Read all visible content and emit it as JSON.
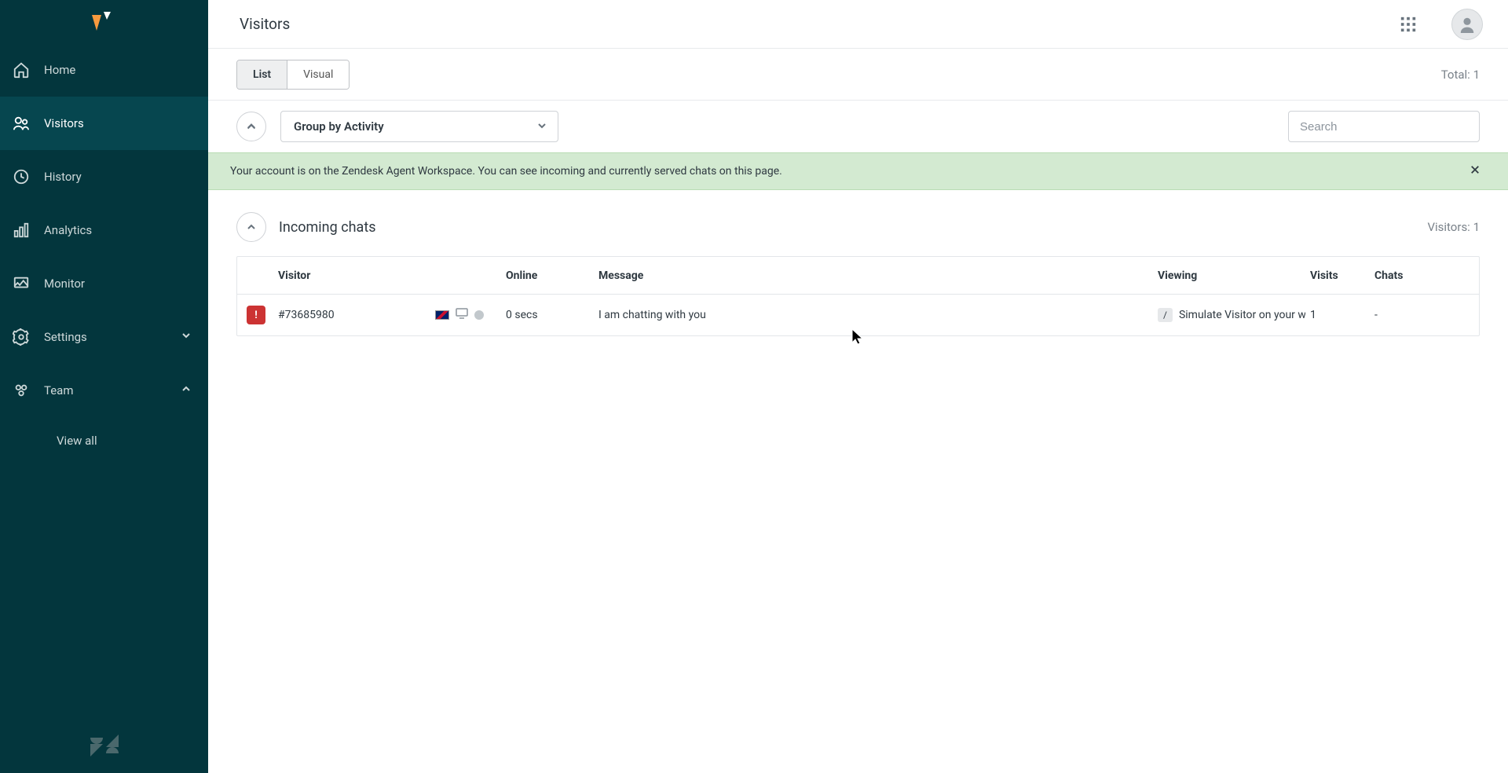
{
  "header": {
    "title": "Visitors"
  },
  "sidebar": {
    "items": [
      {
        "label": "Home"
      },
      {
        "label": "Visitors"
      },
      {
        "label": "History"
      },
      {
        "label": "Analytics"
      },
      {
        "label": "Monitor"
      },
      {
        "label": "Settings"
      },
      {
        "label": "Team"
      }
    ],
    "subitems": [
      {
        "label": "View all"
      }
    ]
  },
  "toolbar": {
    "view_list_label": "List",
    "view_visual_label": "Visual",
    "total_label": "Total:",
    "total_value": "1"
  },
  "filterbar": {
    "group_by_label": "Group by Activity",
    "search_placeholder": "Search"
  },
  "banner": {
    "text": "Your account is on the Zendesk Agent Workspace. You can see incoming and currently served chats on this page."
  },
  "section": {
    "title": "Incoming chats",
    "visitors_label": "Visitors:",
    "visitors_value": "1"
  },
  "table": {
    "headers": {
      "visitor": "Visitor",
      "online": "Online",
      "message": "Message",
      "viewing": "Viewing",
      "visits": "Visits",
      "chats": "Chats"
    },
    "rows": [
      {
        "status_badge": "!",
        "visitor": "#73685980",
        "online": "0 secs",
        "message": "I am chatting with you",
        "viewing_path": "/",
        "viewing_label": "Simulate Visitor on your website - Zendesk Chat",
        "visits": "1",
        "chats": "-"
      }
    ]
  }
}
